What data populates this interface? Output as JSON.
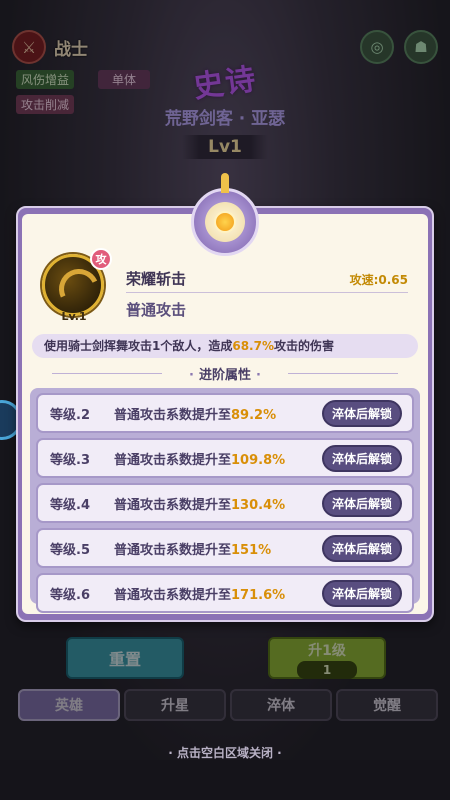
{
  "background": {
    "role_name": "战士",
    "tags": [
      "风伤增益",
      "攻击削减"
    ],
    "target_tag": "单体",
    "rarity": "史诗",
    "hero_name": "荒野剑客 · 亚瑟",
    "hero_level": "Lv1"
  },
  "dialog": {
    "skill": {
      "badge": "攻",
      "level": "Lv.1",
      "name": "荣耀斩击",
      "speed": "攻速:0.65",
      "type": "普通攻击"
    },
    "description": {
      "prefix": "使用骑士剑挥舞攻击1个敌人，造成",
      "value": "68.7%",
      "suffix": "攻击的伤害"
    },
    "advanced_header": "进阶属性",
    "advanced_rows": [
      {
        "level": "等级.2",
        "text": "普通攻击系数提升至",
        "value": "89.2%",
        "button": "淬体后解锁"
      },
      {
        "level": "等级.3",
        "text": "普通攻击系数提升至",
        "value": "109.8%",
        "button": "淬体后解锁"
      },
      {
        "level": "等级.4",
        "text": "普通攻击系数提升至",
        "value": "130.4%",
        "button": "淬体后解锁"
      },
      {
        "level": "等级.5",
        "text": "普通攻击系数提升至",
        "value": "151%",
        "button": "淬体后解锁"
      },
      {
        "level": "等级.6",
        "text": "普通攻击系数提升至",
        "value": "171.6%",
        "button": "淬体后解锁"
      }
    ]
  },
  "controls": {
    "reset_label": "重置",
    "upgrade_label": "升1级",
    "upgrade_count": "1",
    "tabs": [
      "英雄",
      "升星",
      "淬体",
      "觉醒"
    ],
    "active_tab": "英雄"
  },
  "close_hint": "· 点击空白区域关闭 ·"
}
